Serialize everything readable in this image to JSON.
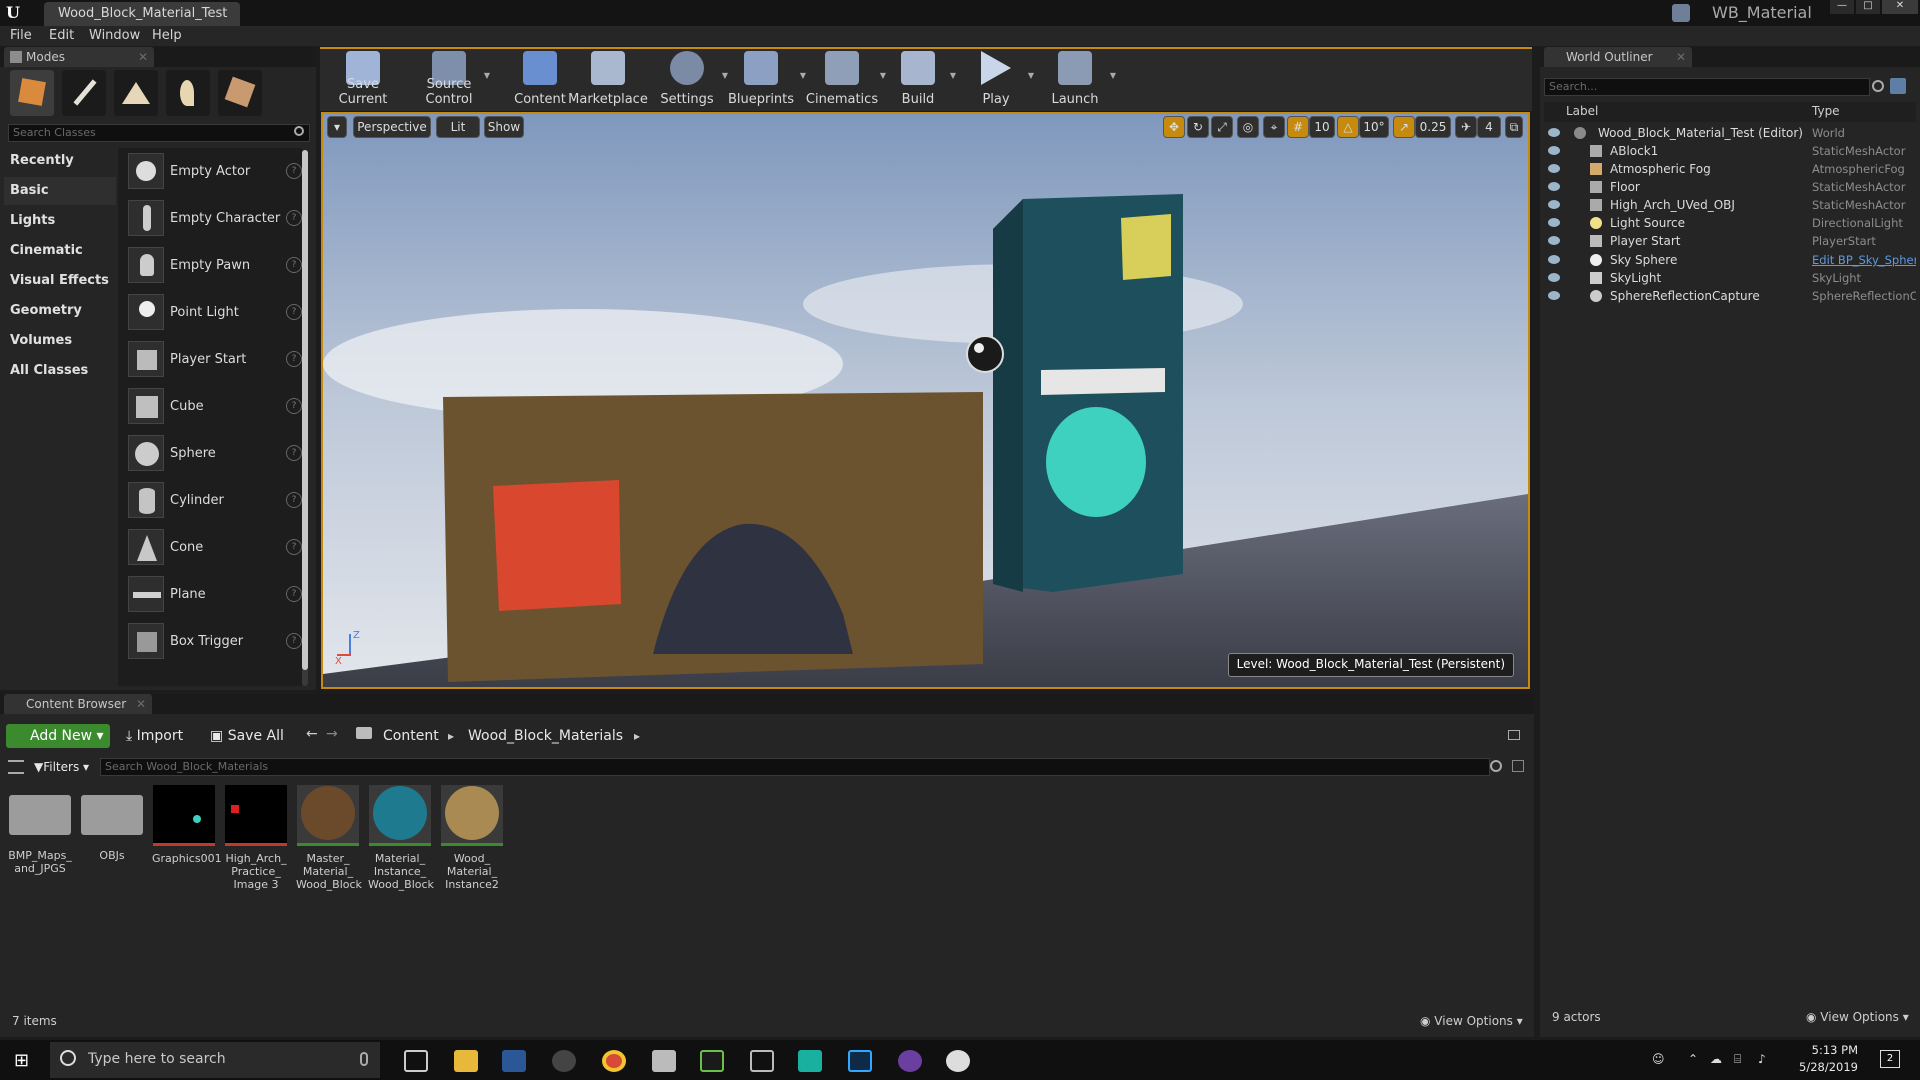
{
  "titlebar": {
    "doc_tab": "Wood_Block_Material_Test",
    "project_name": "WB_Material"
  },
  "menu": [
    "File",
    "Edit",
    "Window",
    "Help"
  ],
  "modes": {
    "tab_label": "Modes",
    "search_placeholder": "Search Classes",
    "categories": [
      "Recently Placed",
      "Basic",
      "Lights",
      "Cinematic",
      "Visual Effects",
      "Geometry",
      "Volumes",
      "All Classes"
    ],
    "active_category": "Basic",
    "items": [
      "Empty Actor",
      "Empty Character",
      "Empty Pawn",
      "Point Light",
      "Player Start",
      "Cube",
      "Sphere",
      "Cylinder",
      "Cone",
      "Plane",
      "Box Trigger"
    ]
  },
  "toolbar": {
    "buttons": [
      "Save Current",
      "Source Control",
      "Content",
      "Marketplace",
      "Settings",
      "Blueprints",
      "Cinematics",
      "Build",
      "Play",
      "Launch"
    ]
  },
  "viewport": {
    "perspective": "Perspective",
    "lit": "Lit",
    "show": "Show",
    "grid_snap": "10",
    "rotation_snap": "10°",
    "scale_snap": "0.25",
    "camera_speed": "4",
    "level_label": "Level:  Wood_Block_Material_Test (Persistent)",
    "axis_z": "Z",
    "axis_x": "X"
  },
  "outliner": {
    "tab_label": "World Outliner",
    "search_placeholder": "Search...",
    "col_label": "Label",
    "col_type": "Type",
    "rows": [
      {
        "label": "Wood_Block_Material_Test (Editor)",
        "type": "World"
      },
      {
        "label": "ABlock1",
        "type": "StaticMeshActor"
      },
      {
        "label": "Atmospheric Fog",
        "type": "AtmosphericFog"
      },
      {
        "label": "Floor",
        "type": "StaticMeshActor"
      },
      {
        "label": "High_Arch_UVed_OBJ",
        "type": "StaticMeshActor"
      },
      {
        "label": "Light Source",
        "type": "DirectionalLight"
      },
      {
        "label": "Player Start",
        "type": "PlayerStart"
      },
      {
        "label": "Sky Sphere",
        "type": "Edit BP_Sky_Sphere"
      },
      {
        "label": "SkyLight",
        "type": "SkyLight"
      },
      {
        "label": "SphereReflectionCapture",
        "type": "SphereReflectionCapture"
      }
    ],
    "count": "9 actors",
    "view_options": "View Options"
  },
  "content_browser": {
    "tab_label": "Content Browser",
    "add_new": "Add New",
    "import": "Import",
    "save_all": "Save All",
    "path": [
      "Content",
      "Wood_Block_Materials"
    ],
    "filters": "Filters",
    "search_placeholder": "Search Wood_Block_Materials",
    "assets": [
      {
        "name": "BMP_Maps_ and_JPGS",
        "kind": "folder"
      },
      {
        "name": "OBJs",
        "kind": "folder"
      },
      {
        "name": "Graphics001",
        "kind": "texture"
      },
      {
        "name": "High_Arch_ Practice_ Image 3",
        "kind": "texture"
      },
      {
        "name": "Master_ Material_ Wood_Block",
        "kind": "material"
      },
      {
        "name": "Material_ Instance_ Wood_Block",
        "kind": "material"
      },
      {
        "name": "Wood_ Material_ Instance2",
        "kind": "material"
      }
    ],
    "item_count": "7 items",
    "view_options": "View Options"
  },
  "taskbar": {
    "search_placeholder": "Type here to search",
    "time": "5:13 PM",
    "date": "5/28/2019",
    "notification_count": "2"
  },
  "colors": {
    "accent": "#c68a0f",
    "add_new_green": "#3c8a2e",
    "wood": "#6b5330",
    "teal_block": "#1d4f5c",
    "red_square": "#d9472f",
    "yellow_square": "#d8cf5a",
    "cyan_circle": "#3fd1bf"
  }
}
